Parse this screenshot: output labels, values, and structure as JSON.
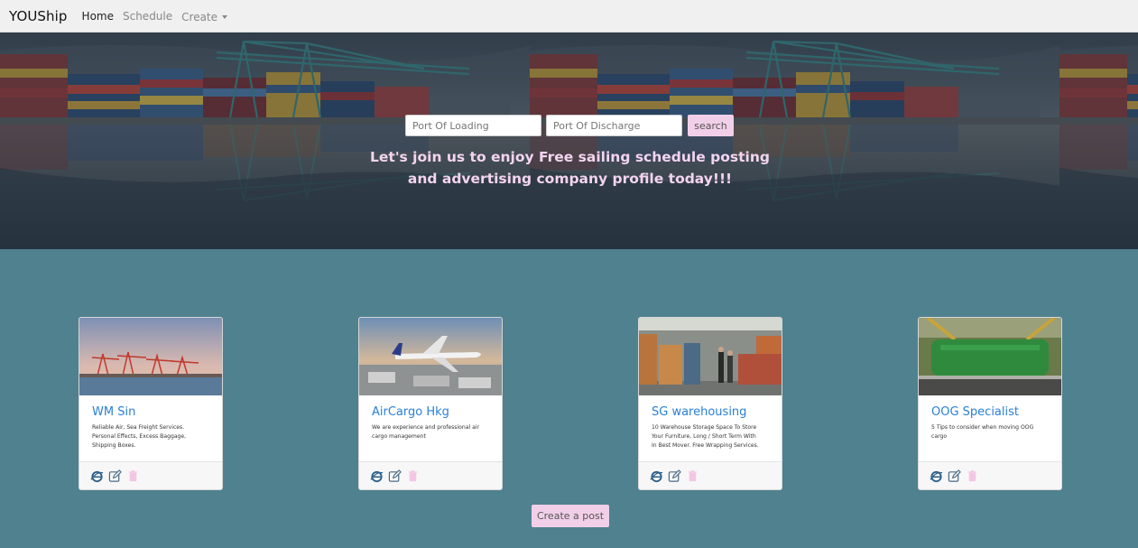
{
  "navbar": {
    "brand": "YOUShip",
    "links": [
      "Home",
      "Schedule",
      "Create"
    ]
  },
  "hero": {
    "loading_placeholder": "Port Of Loading",
    "discharge_placeholder": "Port Of Discharge",
    "search_label": "search",
    "tagline_line1": "Let's join us to enjoy Free sailing schedule posting",
    "tagline_line2": "and advertising company profile today!!!"
  },
  "cards": [
    {
      "title": "WM Sin",
      "text": "Reliable Air, Sea Freight Services. Personal Effects, Excess Baggage, Shipping Boxes."
    },
    {
      "title": "AirCargo Hkg",
      "text": "We are experience and professional air cargo management"
    },
    {
      "title": "SG warehousing",
      "text": "10 Warehouse Storage Space To Store Your Furniture, Long / Short Term With In Best Mover. Free Wrapping Services."
    },
    {
      "title": "OOG Specialist",
      "text": "5 Tips to consider when moving OOG cargo"
    }
  ],
  "create_post_label": "Create a post",
  "colors": {
    "navbar_bg": "#f0f0f0",
    "page_bg": "#4f818f",
    "accent_pink": "#f2cfe8",
    "title_blue": "#2a80d8",
    "tagline_pink": "#f3d4ef"
  },
  "icons": [
    "internet-explorer-icon",
    "edit-icon",
    "trash-icon"
  ]
}
